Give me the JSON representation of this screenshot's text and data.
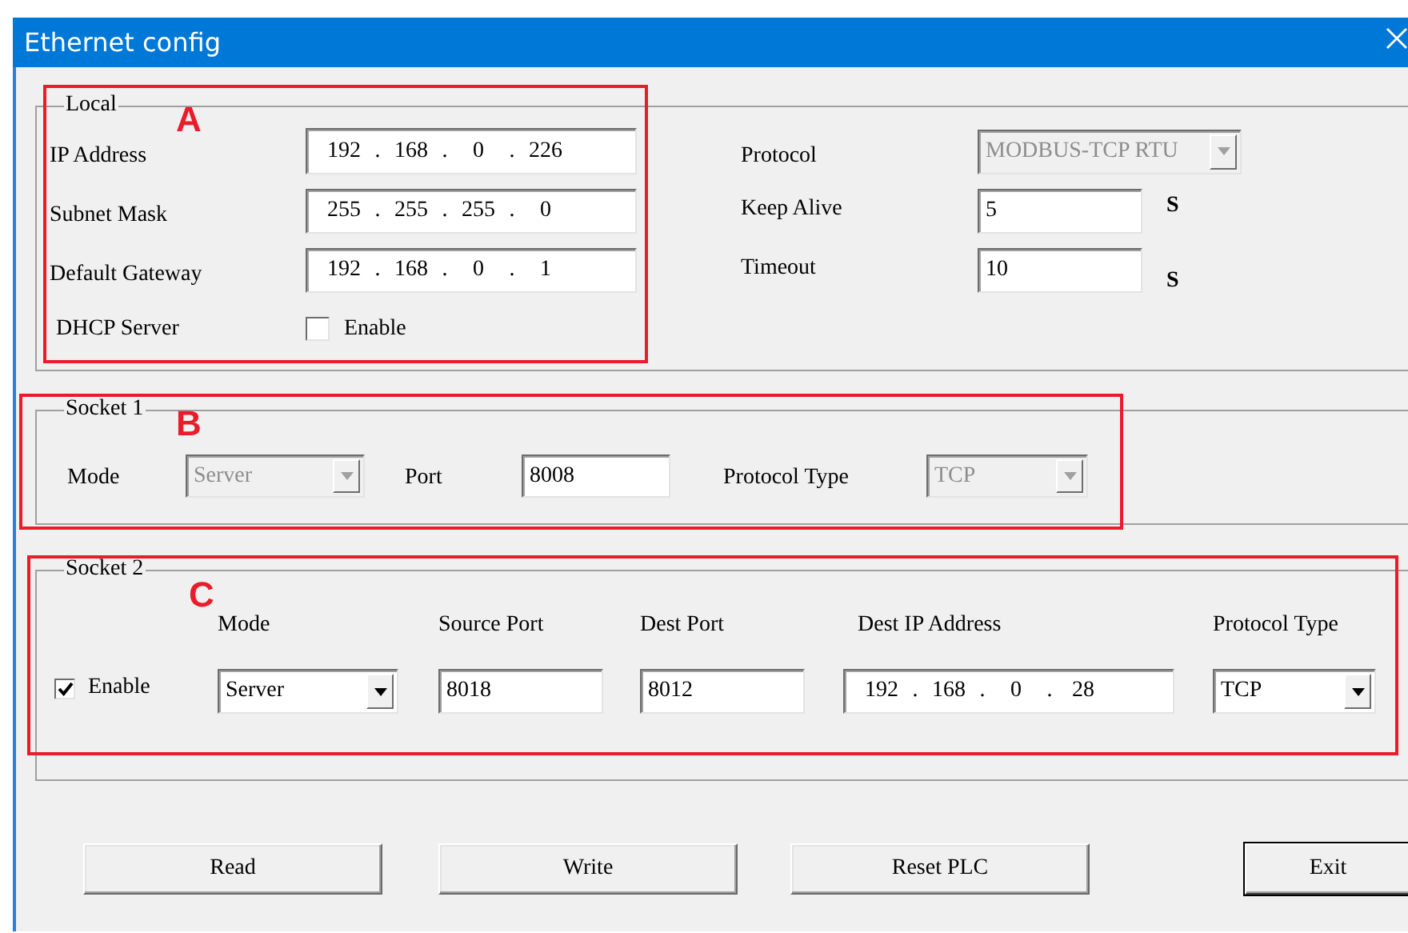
{
  "window": {
    "title": "Ethernet config"
  },
  "local": {
    "title": "Local",
    "fields": [
      {
        "label": "IP Address",
        "value": "192 . 168 . 0 . 226"
      },
      {
        "label": "Subnet Mask",
        "value": "255 . 255 . 255 . 0"
      },
      {
        "label": "Default Gateway",
        "value": "192 . 168 . 0 . 1"
      }
    ],
    "dhcp": {
      "label": "DHCP Server",
      "option": "Enable",
      "checked": false
    },
    "protocol": {
      "label": "Protocol",
      "value": "MODBUS-TCP RTU",
      "disabled": true
    },
    "keep_alive": {
      "label": "Keep Alive",
      "value": "5",
      "unit": "S"
    },
    "timeout": {
      "label": "Timeout",
      "value": "10",
      "unit": "S"
    }
  },
  "socket1": {
    "title": "Socket 1",
    "mode": {
      "label": "Mode",
      "value": "Server",
      "disabled": true
    },
    "port": {
      "label": "Port",
      "value": "8008"
    },
    "protocol_type": {
      "label": "Protocol Type",
      "value": "TCP",
      "disabled": true
    }
  },
  "socket2": {
    "title": "Socket 2",
    "enable": {
      "label": "Enable",
      "checked": true
    },
    "columns": [
      "Mode",
      "Source Port",
      "Dest Port",
      "Dest IP Address",
      "Protocol Type"
    ],
    "mode": {
      "value": "Server",
      "disabled": false
    },
    "source_port": "8018",
    "dest_port": "8012",
    "dest_ip": "192 . 168 . 0 . 28",
    "protocol_type": {
      "value": "TCP",
      "disabled": false
    }
  },
  "buttons": [
    {
      "label": "Read",
      "default": false
    },
    {
      "label": "Write",
      "default": false
    },
    {
      "label": "Reset PLC",
      "default": false
    },
    {
      "label": "Exit",
      "default": true
    }
  ],
  "annotations": [
    {
      "label": "A"
    },
    {
      "label": "B"
    },
    {
      "label": "C"
    }
  ]
}
